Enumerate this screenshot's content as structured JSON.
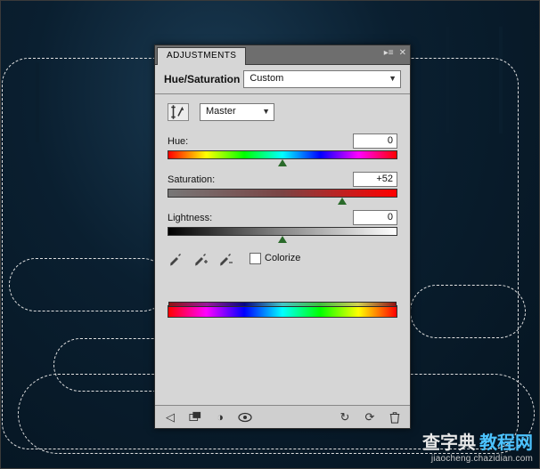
{
  "panel": {
    "tab_label": "ADJUSTMENTS",
    "title": "Hue/Saturation",
    "preset": "Custom",
    "channel": "Master",
    "hue": {
      "label": "Hue:",
      "value": "0",
      "pos_pct": 50
    },
    "saturation": {
      "label": "Saturation:",
      "value": "+52",
      "pos_pct": 76
    },
    "lightness": {
      "label": "Lightness:",
      "value": "0",
      "pos_pct": 50
    },
    "colorize_label": "Colorize",
    "colorize_checked": false
  },
  "icons": {
    "target_adjust": "target-adjust-icon",
    "eyedropper": "eyedropper-icon",
    "eyedropper_plus": "eyedropper-plus-icon",
    "eyedropper_minus": "eyedropper-minus-icon",
    "footer": {
      "back": "back-icon",
      "new_layer": "new-adjustment-layer-icon",
      "clip": "clip-to-layer-icon",
      "visibility": "visibility-icon",
      "prev_state": "previous-state-icon",
      "reset": "reset-icon",
      "trash": "trash-icon"
    }
  },
  "watermark": {
    "text_zh": "查字典",
    "text_sp": "教程网",
    "url": "jiaocheng.chazidian.com"
  }
}
